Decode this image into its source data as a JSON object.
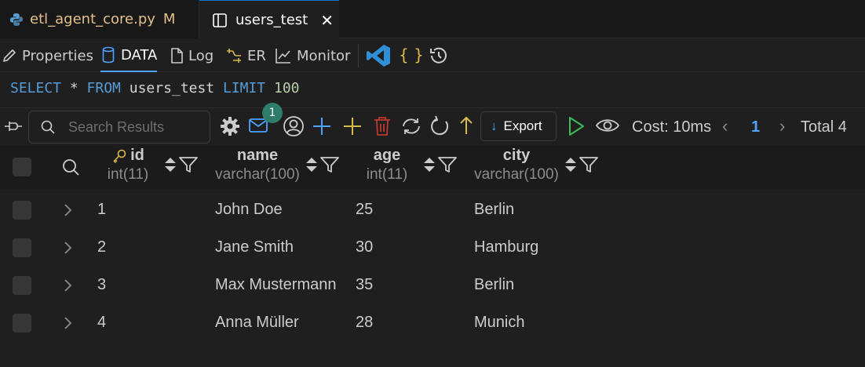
{
  "tabs": [
    {
      "label": "etl_agent_core.py",
      "badge": "M",
      "icon": "python-icon"
    },
    {
      "label": "users_test",
      "icon": "split-editor-icon",
      "close": "✕"
    }
  ],
  "panel_tabs": [
    {
      "label": "Properties",
      "icon": "pencil-icon"
    },
    {
      "label": "DATA",
      "icon": "database-icon"
    },
    {
      "label": "Log",
      "icon": "file-icon"
    },
    {
      "label": "ER",
      "icon": "er-diagram-icon"
    },
    {
      "label": "Monitor",
      "icon": "chart-line-icon"
    }
  ],
  "sql": {
    "k1": "SELECT",
    "t1": " * ",
    "k2": "FROM",
    "t2": " users_test ",
    "k3": "LIMIT",
    "t3": " ",
    "n": "100"
  },
  "results_toolbar": {
    "search_placeholder": "Search Results",
    "badge_count": "1",
    "export_label": "Export",
    "cost": "Cost: 10ms",
    "page": "1",
    "total": "Total 4",
    "prev": "‹",
    "next": "›"
  },
  "columns": [
    {
      "name": "id",
      "type": "int(11)",
      "key": true
    },
    {
      "name": "name",
      "type": "varchar(100)"
    },
    {
      "name": "age",
      "type": "int(11)"
    },
    {
      "name": "city",
      "type": "varchar(100)"
    }
  ],
  "rows": [
    [
      "1",
      "John Doe",
      "25",
      "Berlin"
    ],
    [
      "2",
      "Jane Smith",
      "30",
      "Hamburg"
    ],
    [
      "3",
      "Max Mustermann",
      "35",
      "Berlin"
    ],
    [
      "4",
      "Anna Müller",
      "28",
      "Munich"
    ]
  ],
  "colors": {
    "accent": "#4da3ff",
    "modified": "#e2c08d",
    "badge": "#2e7d6b",
    "run": "#3dbb5b",
    "delete": "#c0392b",
    "plus": "#d7ba4a"
  }
}
